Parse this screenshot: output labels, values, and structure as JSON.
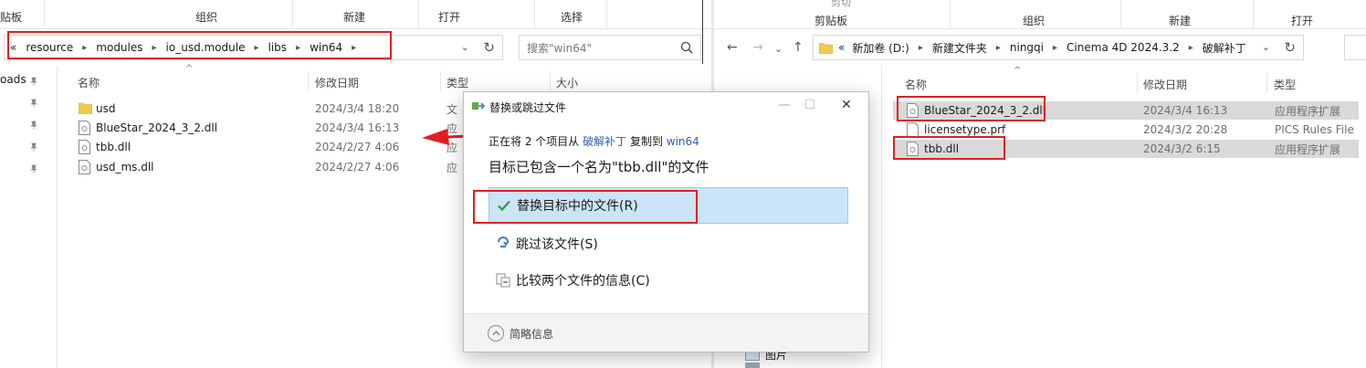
{
  "left": {
    "ribbon": [
      "贴板",
      "组织",
      "新建",
      "打开",
      "选择"
    ],
    "address": {
      "lead": "«",
      "crumbs": [
        "resource",
        "modules",
        "io_usd.module",
        "libs",
        "win64"
      ]
    },
    "search_placeholder": "搜索\"win64\"",
    "columns": {
      "name": "名称",
      "date": "修改日期",
      "type": "类型",
      "size": "大小"
    },
    "nav": [
      {
        "label": "oads"
      }
    ],
    "files": [
      {
        "name": "usd",
        "date": "2024/3/4 18:20",
        "type": "文",
        "icon": "folder-icon"
      },
      {
        "name": "BlueStar_2024_3_2.dll",
        "date": "2024/3/4 16:13",
        "type": "应",
        "icon": "dll-file-icon"
      },
      {
        "name": "tbb.dll",
        "date": "2024/2/27 4:06",
        "type": "应",
        "icon": "dll-file-icon"
      },
      {
        "name": "usd_ms.dll",
        "date": "2024/2/27 4:06",
        "type": "应",
        "icon": "dll-file-icon"
      }
    ]
  },
  "right": {
    "ribbon": [
      "剪贴板",
      "组织",
      "新建",
      "打开"
    ],
    "ribbon_top": [
      "剪切"
    ],
    "address": {
      "lead": "«",
      "crumbs": [
        "新加卷 (D:)",
        "新建文件夹",
        "ningqi",
        "Cinema 4D 2024.3.2",
        "破解补丁"
      ]
    },
    "columns": {
      "name": "名称",
      "date": "修改日期",
      "type": "类型"
    },
    "files": [
      {
        "name": "BlueStar_2024_3_2.dll",
        "date": "2024/3/4 16:13",
        "type": "应用程序扩展",
        "icon": "dll-file-icon",
        "selected": true
      },
      {
        "name": "licensetype.prf",
        "date": "2024/3/2 20:28",
        "type": "PICS Rules File",
        "icon": "file-icon",
        "selected": false
      },
      {
        "name": "tbb.dll",
        "date": "2024/3/2 6:15",
        "type": "应用程序扩展",
        "icon": "dll-file-icon",
        "selected": true
      }
    ],
    "bottom_nav": "图片"
  },
  "dialog": {
    "title": "替换或跳过文件",
    "progress": {
      "prefix": "正在将 2 个项目从",
      "source": "破解补丁",
      "middle": "复制到",
      "dest": "win64"
    },
    "headline": "目标已包含一个名为\"tbb.dll\"的文件",
    "options": [
      {
        "label": "替换目标中的文件(R)",
        "icon": "checkmark-icon"
      },
      {
        "label": "跳过该文件(S)",
        "icon": "skip-icon"
      },
      {
        "label": "比较两个文件的信息(C)",
        "icon": "compare-icon"
      }
    ],
    "details": "简略信息"
  },
  "colors": {
    "accent": "#2a5fb0",
    "highlight": "#cce4f7",
    "annotation": "#e02020"
  }
}
